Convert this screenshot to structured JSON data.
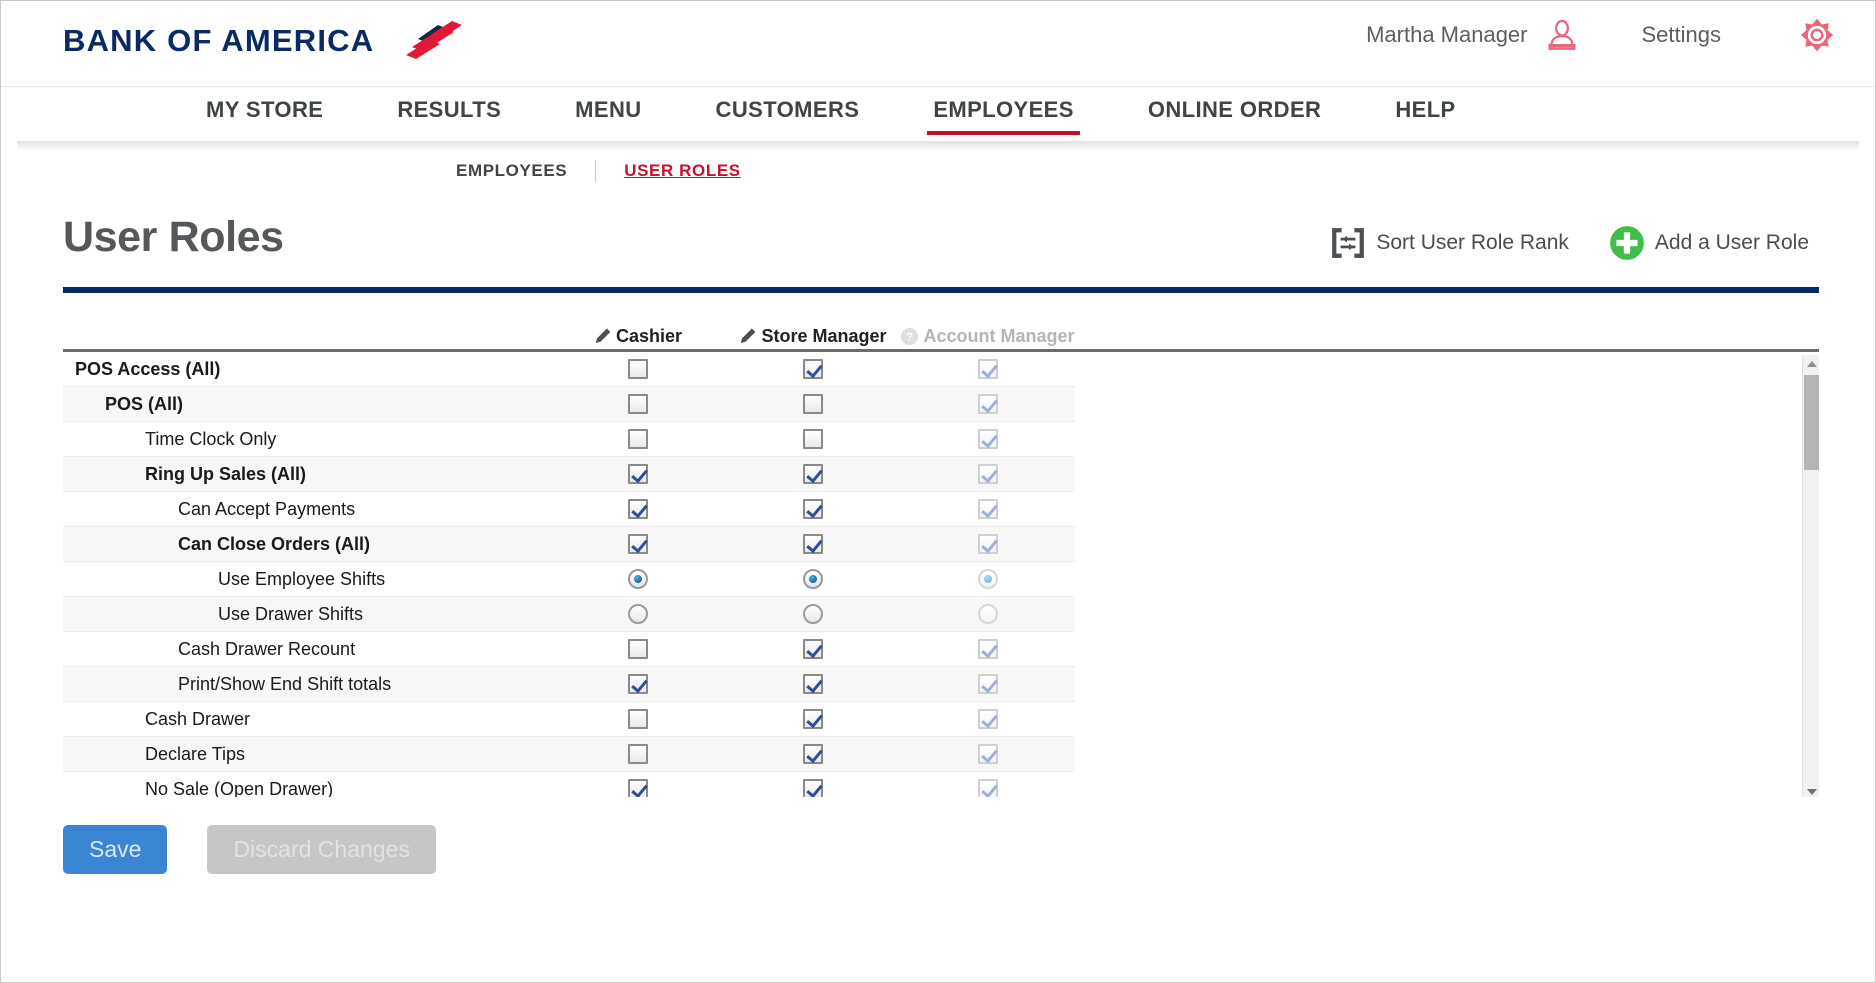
{
  "brand": {
    "name": "BANK OF AMERICA",
    "logo_navy": "#0a2a66",
    "logo_red": "#e31837"
  },
  "header": {
    "account_name": "Martha Manager",
    "settings_label": "Settings",
    "user_icon": "user-icon",
    "gear_icon": "gear-icon",
    "icon_color": "#e8657a"
  },
  "main_nav": {
    "items": [
      {
        "label": "MY STORE",
        "active": false
      },
      {
        "label": "RESULTS",
        "active": false
      },
      {
        "label": "MENU",
        "active": false
      },
      {
        "label": "CUSTOMERS",
        "active": false
      },
      {
        "label": "EMPLOYEES",
        "active": true
      },
      {
        "label": "ONLINE ORDER",
        "active": false
      },
      {
        "label": "HELP",
        "active": false
      }
    ],
    "active_underline_color": "#c8102e"
  },
  "sub_nav": {
    "items": [
      {
        "label": "EMPLOYEES",
        "active": false
      },
      {
        "label": "USER ROLES",
        "active": true
      }
    ]
  },
  "page": {
    "title": "User Roles",
    "rule_color": "#0a2a66"
  },
  "header_actions": [
    {
      "label": "Sort User Role Rank",
      "icon": "sort-rank-icon"
    },
    {
      "label": "Add a User Role",
      "icon": "plus-circle-icon"
    }
  ],
  "table": {
    "row_label_header": "",
    "columns": [
      {
        "label": "Cashier",
        "icon": "pencil-icon",
        "disabled": false
      },
      {
        "label": "Store Manager",
        "icon": "pencil-icon",
        "disabled": false
      },
      {
        "label": "Account Manager",
        "icon": "question-circle-icon",
        "disabled": true
      }
    ],
    "rows": [
      {
        "label": "POS Access (All)",
        "bold": true,
        "indent": 0,
        "control": "checkbox",
        "values": [
          false,
          true,
          true
        ]
      },
      {
        "label": "POS (All)",
        "bold": true,
        "indent": 1,
        "control": "checkbox",
        "values": [
          false,
          false,
          true
        ]
      },
      {
        "label": "Time Clock Only",
        "bold": false,
        "indent": 2,
        "control": "checkbox",
        "values": [
          false,
          false,
          true
        ]
      },
      {
        "label": "Ring Up Sales (All)",
        "bold": true,
        "indent": 2,
        "control": "checkbox",
        "values": [
          true,
          true,
          true
        ]
      },
      {
        "label": "Can Accept Payments",
        "bold": false,
        "indent": 3,
        "control": "checkbox",
        "values": [
          true,
          true,
          true
        ]
      },
      {
        "label": "Can Close Orders (All)",
        "bold": true,
        "indent": 3,
        "control": "checkbox",
        "values": [
          true,
          true,
          true
        ]
      },
      {
        "label": "Use Employee Shifts",
        "bold": false,
        "indent": 4,
        "control": "radio",
        "values": [
          true,
          true,
          true
        ]
      },
      {
        "label": "Use Drawer Shifts",
        "bold": false,
        "indent": 4,
        "control": "radio",
        "values": [
          false,
          false,
          false
        ]
      },
      {
        "label": "Cash Drawer Recount",
        "bold": false,
        "indent": 3,
        "control": "checkbox",
        "values": [
          false,
          true,
          true
        ]
      },
      {
        "label": "Print/Show End Shift totals",
        "bold": false,
        "indent": 3,
        "control": "checkbox",
        "values": [
          true,
          true,
          true
        ]
      },
      {
        "label": "Cash Drawer",
        "bold": false,
        "indent": 2,
        "control": "checkbox",
        "values": [
          false,
          true,
          true
        ]
      },
      {
        "label": "Declare Tips",
        "bold": false,
        "indent": 2,
        "control": "checkbox",
        "values": [
          false,
          true,
          true
        ]
      },
      {
        "label": "No Sale (Open Drawer)",
        "bold": false,
        "indent": 2,
        "control": "checkbox",
        "values": [
          true,
          true,
          true
        ]
      }
    ]
  },
  "scrollbar": {
    "up_arrow": "caret-up-icon",
    "down_arrow": "caret-down-icon",
    "thumb": "scroll-thumb"
  },
  "footer": {
    "save_label": "Save",
    "discard_label": "Discard Changes",
    "save_color": "#3b86d4",
    "discard_color": "#c6c6c6"
  }
}
